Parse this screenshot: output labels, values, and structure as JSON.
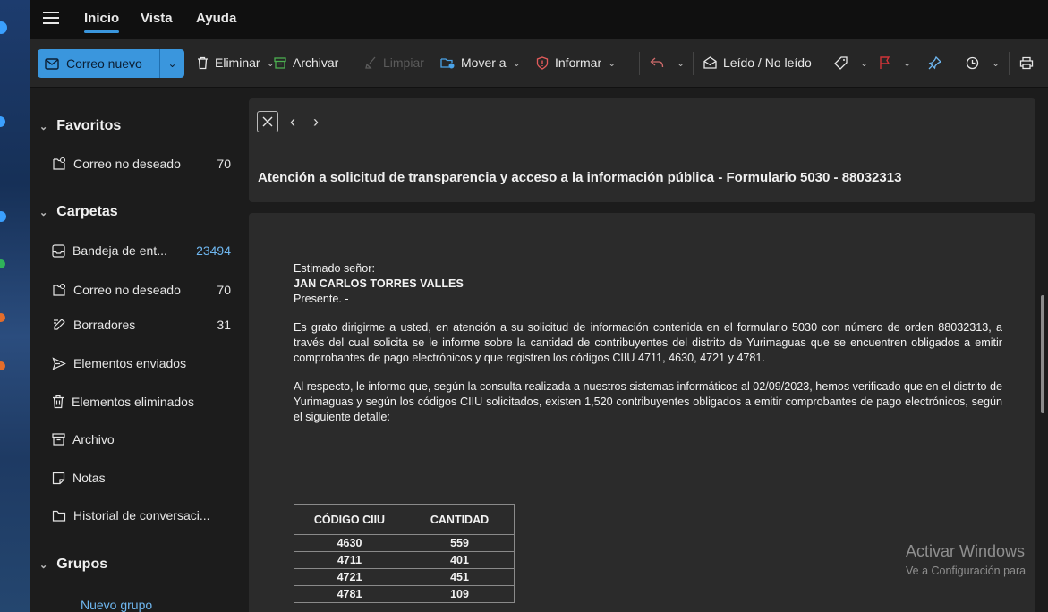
{
  "menubar": {
    "tabs": [
      {
        "label": "Inicio",
        "active": true
      },
      {
        "label": "Vista",
        "active": false
      },
      {
        "label": "Ayuda",
        "active": false
      }
    ]
  },
  "toolbar": {
    "new_mail": "Correo nuevo",
    "delete": "Eliminar",
    "archive": "Archivar",
    "clean": "Limpiar",
    "move": "Mover a",
    "report": "Informar",
    "read_unread": "Leído / No leído",
    "colors": {
      "accent": "#3a96dd",
      "report_icon": "#e35b5b",
      "flag": "#d13438",
      "pin": "#6fb7f0",
      "move_icon": "#4aa3e8",
      "archive_icon": "#4caf50"
    }
  },
  "sidebar": {
    "favorites_title": "Favoritos",
    "favorites": [
      {
        "label": "Correo no deseado",
        "count": "70",
        "icon": "junk-icon"
      }
    ],
    "folders_title": "Carpetas",
    "folders": [
      {
        "label": "Bandeja de ent...",
        "count": "23494",
        "icon": "inbox-icon"
      },
      {
        "label": "Correo no deseado",
        "count": "70",
        "icon": "junk-icon"
      },
      {
        "label": "Borradores",
        "count": "31",
        "icon": "drafts-icon"
      },
      {
        "label": "Elementos enviados",
        "count": "",
        "icon": "sent-icon"
      },
      {
        "label": "Elementos eliminados",
        "count": "",
        "icon": "trash-icon"
      },
      {
        "label": "Archivo",
        "count": "",
        "icon": "archive-icon"
      },
      {
        "label": "Notas",
        "count": "",
        "icon": "notes-icon"
      },
      {
        "label": "Historial de conversaci...",
        "count": "",
        "icon": "history-icon"
      }
    ],
    "groups_title": "Grupos",
    "new_group": "Nuevo grupo"
  },
  "message": {
    "subject": "Atención a solicitud de transparencia y acceso a la información pública - Formulario 5030 - 88032313",
    "greeting": "Estimado señor:",
    "recipient": "JAN CARLOS TORRES VALLES",
    "presente": "Presente. -",
    "para1": "Es grato dirigirme a usted, en atención a su solicitud de información contenida en el formulario 5030 con número de orden 88032313, a través del cual solicita se le informe sobre la cantidad de contribuyentes del distrito de Yurimaguas que se encuentren obligados a emitir comprobantes de pago electrónicos y que registren los códigos CIIU 4711, 4630, 4721 y 4781.",
    "para2": "Al respecto, le informo que, según la consulta realizada a nuestros sistemas informáticos al 02/09/2023, hemos verificado que en el distrito de Yurimaguas y según los códigos CIIU solicitados, existen 1,520 contribuyentes obligados a emitir comprobantes de pago electrónicos, según el siguiente detalle:",
    "table": {
      "headers": [
        "CÓDIGO CIIU",
        "CANTIDAD"
      ],
      "rows": [
        [
          "4630",
          "559"
        ],
        [
          "4711",
          "401"
        ],
        [
          "4721",
          "451"
        ],
        [
          "4781",
          "109"
        ]
      ]
    }
  },
  "watermark": {
    "line1": "Activar Windows",
    "line2": "Ve a Configuración para"
  }
}
